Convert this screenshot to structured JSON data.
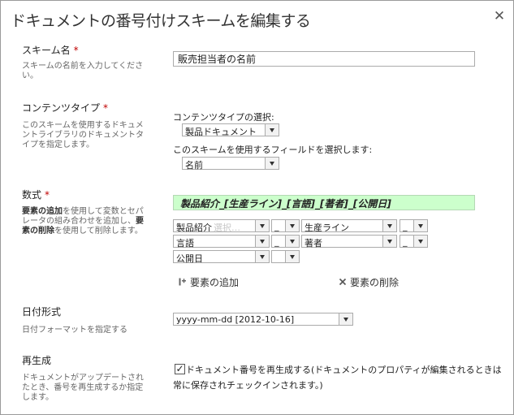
{
  "dialog": {
    "title": "ドキュメントの番号付けスキームを編集する",
    "close_glyph": "✕"
  },
  "scheme_name": {
    "label": "スキーム名",
    "required_mark": "*",
    "description": "スキームの名前を入力してください。",
    "value": "販売担当者の名前"
  },
  "content_type": {
    "label": "コンテンツタイプ",
    "required_mark": "*",
    "description": "このスキームを使用するドキュメントライブラリのドキュメントタイプを指定します。",
    "select_label": "コンテンツタイプの選択:",
    "select_value": "製品ドキュメント",
    "field_label": "このスキームを使用するフィールドを選択します:",
    "field_value": "名前"
  },
  "format": {
    "label": "数式",
    "required_mark": "*",
    "description_parts": [
      "要素の追加",
      "を使用して変数とセパレータの組み合わせを追加し、",
      "要素の削除",
      "を使用して削除します。"
    ],
    "preview": "製品紹介_[生産ライン]_[言語]_[著者]_[公開日]",
    "rows": [
      {
        "a": "製品紹介",
        "a_ghost": "選択…",
        "sep1": "_",
        "b": "生産ライン",
        "sep2": "_"
      },
      {
        "a": "言語",
        "sep1": "_",
        "b": "著者",
        "sep2": "_"
      },
      {
        "a": "公開日",
        "sep1": ""
      }
    ],
    "add_label": "要素の追加",
    "remove_label": "要素の削除",
    "add_icon": "add-element-icon",
    "remove_icon": "remove-element-icon"
  },
  "date_format": {
    "label": "日付形式",
    "description": "日付フォーマットを指定する",
    "value": "yyyy-mm-dd [2012-10-16]"
  },
  "regenerate": {
    "label": "再生成",
    "description": "ドキュメントがアップデートされたとき、番号を再生成するか指定します。",
    "checked": true,
    "check_glyph": "✓",
    "checkbox_line1": "ドキュメント番号を再生成する(ドキュメントのプロパティが編集されるときは",
    "checkbox_line2": "常に保存されチェックインされます。)"
  }
}
